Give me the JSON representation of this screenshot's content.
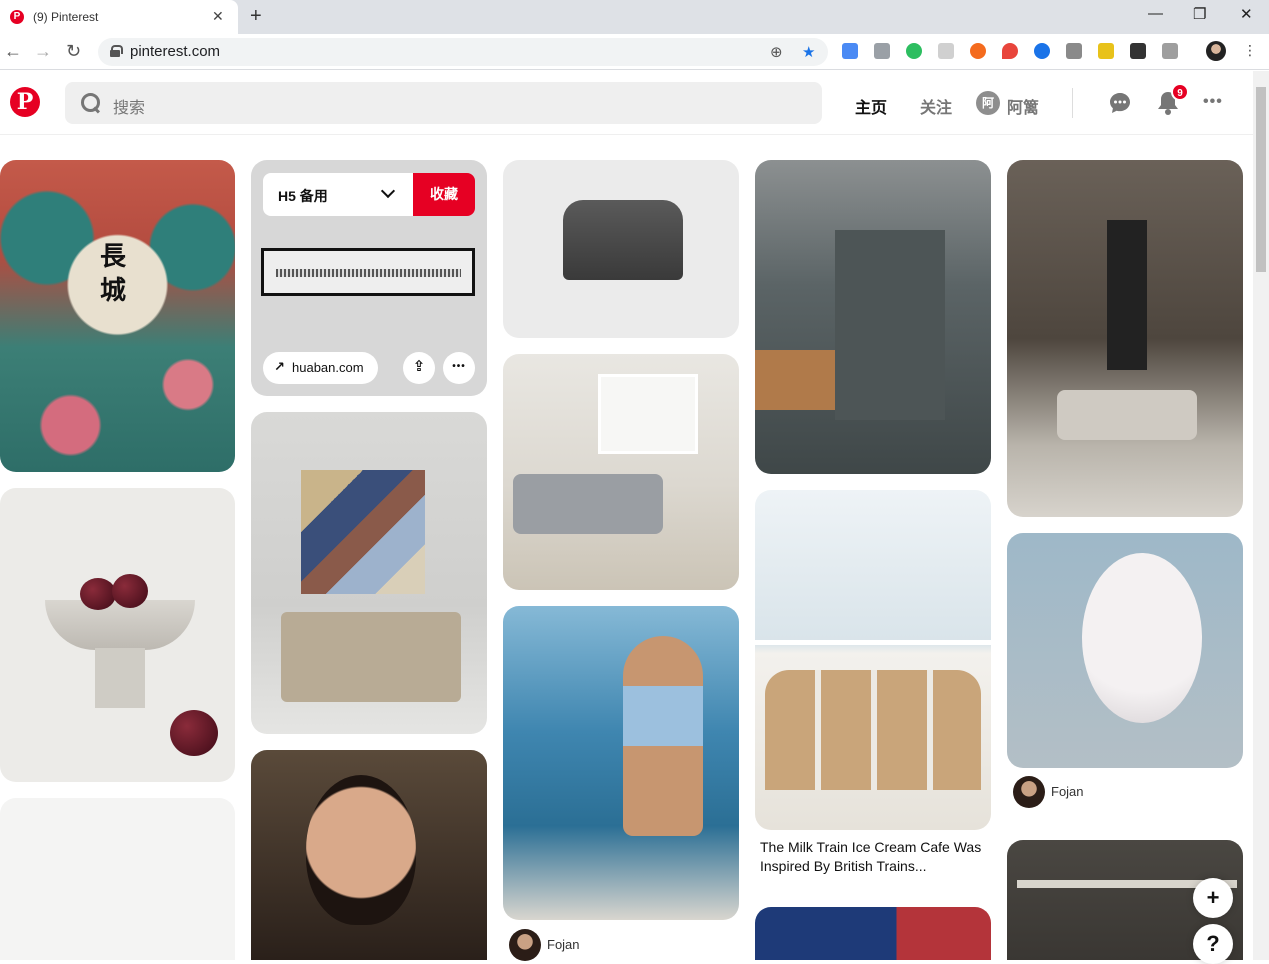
{
  "browser": {
    "tab_title": "(9) Pinterest",
    "tab_close": "✕",
    "new_tab": "+",
    "url": "pinterest.com",
    "window_controls": {
      "minimize": "—",
      "restore": "❐",
      "close": "✕"
    },
    "nav": {
      "back": "←",
      "forward": "→",
      "reload": "↻"
    }
  },
  "header": {
    "logo": "P",
    "search_placeholder": "搜索",
    "nav_home": "主页",
    "nav_following": "关注",
    "profile_avatar_letter": "阿",
    "profile_name": "阿篱",
    "notifications_count": "9",
    "messages_icon": "chat-bubble-icon",
    "more": "•••"
  },
  "hover_pin": {
    "board_name": "H5 备用",
    "save_label": "收藏",
    "source_link": "huaban.com",
    "link_arrow": "↗",
    "upload": "⇪",
    "more": "•••"
  },
  "pins": [
    {
      "caption": "",
      "user": "Fojan"
    },
    {
      "caption": "The Milk Train Ice Cream Cafe Was Inspired By British Trains...",
      "user": ""
    },
    {
      "caption": "",
      "user": "Fojan"
    }
  ],
  "float_buttons": {
    "add": "+",
    "help": "?"
  },
  "colors": {
    "brand_red": "#e60023",
    "header_text": "#111111",
    "muted": "#767676"
  }
}
